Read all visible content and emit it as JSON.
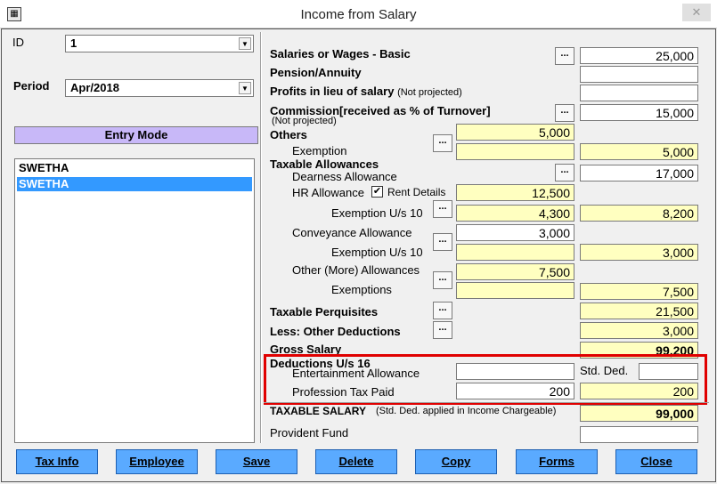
{
  "window": {
    "title": "Income from Salary",
    "app_icon": "calculator-icon",
    "close_icon": "close-icon"
  },
  "left": {
    "id_label": "ID",
    "id_value": "1",
    "period_label": "Period",
    "period_value": "Apr/2018",
    "entry_mode": "Entry Mode",
    "list": [
      {
        "label": "SWETHA",
        "selected": false
      },
      {
        "label": "SWETHA",
        "selected": true
      }
    ]
  },
  "form": {
    "basic": {
      "label": "Salaries or Wages - Basic",
      "value": "25,000"
    },
    "pension": {
      "label": "Pension/Annuity",
      "value": ""
    },
    "profits": {
      "label": "Profits in lieu of salary",
      "note": "(Not projected)",
      "value": ""
    },
    "commission": {
      "label": "Commission[received as % of Turnover]",
      "note": "(Not projected)",
      "value": "15,000"
    },
    "others": {
      "label": "Others",
      "value": "5,000"
    },
    "others_exemption": {
      "label": "Exemption",
      "value": "",
      "total": "5,000"
    },
    "taxable_allowances": {
      "label": "Taxable Allowances"
    },
    "dearness": {
      "label": "Dearness Allowance",
      "total": "17,000"
    },
    "hra": {
      "label": "HR Allowance",
      "rent_label": "Rent Details",
      "rent_checked": true,
      "value": "12,500"
    },
    "hra_exemption": {
      "label": "Exemption U/s 10",
      "value": "4,300",
      "total": "8,200"
    },
    "conveyance": {
      "label": "Conveyance Allowance",
      "value": "3,000"
    },
    "conveyance_exemption": {
      "label": "Exemption U/s 10",
      "value": "",
      "total": "3,000"
    },
    "other_allowances": {
      "label": "Other (More) Allowances",
      "value": "7,500"
    },
    "other_exemptions": {
      "label": "Exemptions",
      "value": "",
      "total": "7,500"
    },
    "perquisites": {
      "label": "Taxable Perquisites",
      "total": "21,500"
    },
    "other_deductions": {
      "label": "Less: Other Deductions",
      "total": "3,000"
    },
    "gross": {
      "label": "Gross Salary",
      "total": "99,200"
    },
    "deductions16": {
      "label": "Deductions U/s 16"
    },
    "entertainment": {
      "label": "Entertainment Allowance",
      "value": ""
    },
    "std_ded": {
      "label": "Std. Ded.",
      "value": ""
    },
    "profession_tax": {
      "label": "Profession Tax Paid",
      "value": "200",
      "total": "200"
    },
    "taxable_salary": {
      "label": "TAXABLE SALARY",
      "note": "(Std. Ded. applied in Income Chargeable)",
      "total": "99,000"
    },
    "provident_fund": {
      "label": "Provident Fund",
      "value": ""
    },
    "dots_label": "..."
  },
  "buttons": [
    "Tax Info",
    "Employee",
    "Save",
    "Delete",
    "Copy",
    "Forms",
    "Close"
  ],
  "colors": {
    "yellow_field": "#ffffc0",
    "button": "#5aaaff",
    "entry_mode": "#c8b8f8",
    "highlight": "#e00000",
    "selection": "#3399ff"
  }
}
